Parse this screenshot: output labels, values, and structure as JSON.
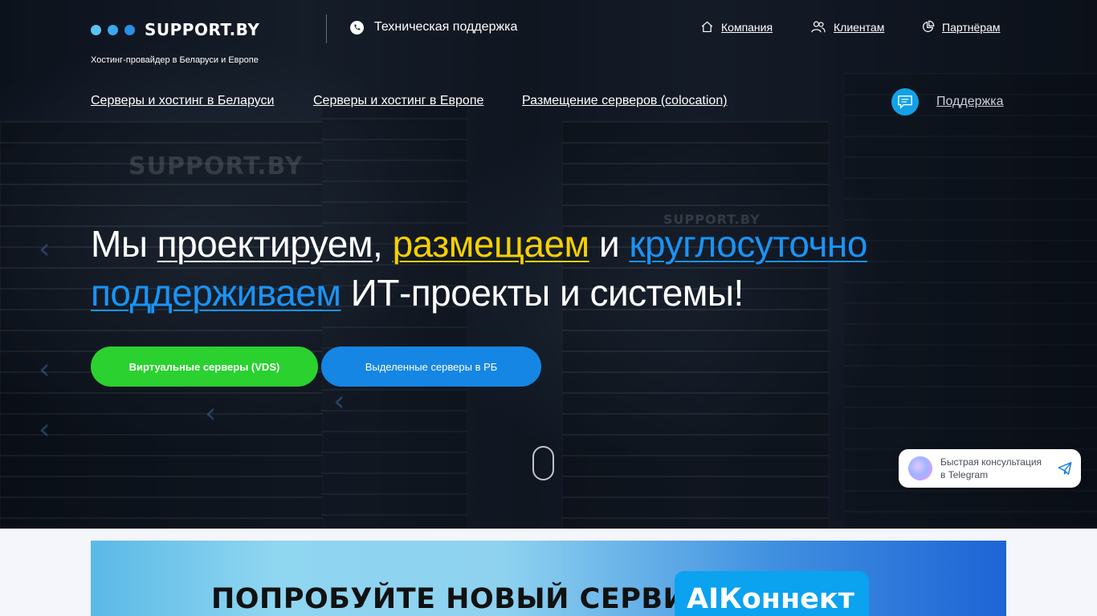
{
  "brand": {
    "logo_text": "SUPPORT.BY",
    "tagline": "Хостинг-провайдер в Беларуси и Европе",
    "watermark": "SUPPORT.BY",
    "dot_colors": [
      "#5bc2f2",
      "#3aa9f0",
      "#2a8fe5"
    ]
  },
  "header": {
    "tech_support": "Техническая поддержка",
    "nav": [
      {
        "label": "Компания",
        "icon": "home-icon"
      },
      {
        "label": "Клиентам",
        "icon": "users-icon"
      },
      {
        "label": "Партнёрам",
        "icon": "pie-chart-icon"
      }
    ]
  },
  "subnav": {
    "items": [
      "Серверы и хостинг в Беларуси",
      "Серверы и хостинг в Европе",
      "Размещение серверов (colocation)"
    ],
    "support_label": "Поддержка"
  },
  "hero": {
    "w1": "Мы",
    "w2": "проектируем",
    "w3": ",",
    "w4": "размещаем",
    "w5": "и",
    "w6": "круглосуточно",
    "w7": "поддерживаем",
    "w8": "ИТ-проекты и системы!",
    "btn_vds": "Виртуальные серверы (VDS)",
    "btn_dedicated": "Выделенные серверы в РБ"
  },
  "telegram": {
    "line1": "Быстрая консультация",
    "line2": "в Telegram"
  },
  "banner": {
    "text": "ПОПРОБУЙТЕ НОВЫЙ СЕРВИС -",
    "pill": "AIКоннект"
  },
  "colors": {
    "accent_green": "#2ad12f",
    "accent_blue": "#1586e4",
    "highlight_yellow": "#f6d000",
    "highlight_blue": "#1a93f5",
    "support_circle": "#12a1e8"
  }
}
